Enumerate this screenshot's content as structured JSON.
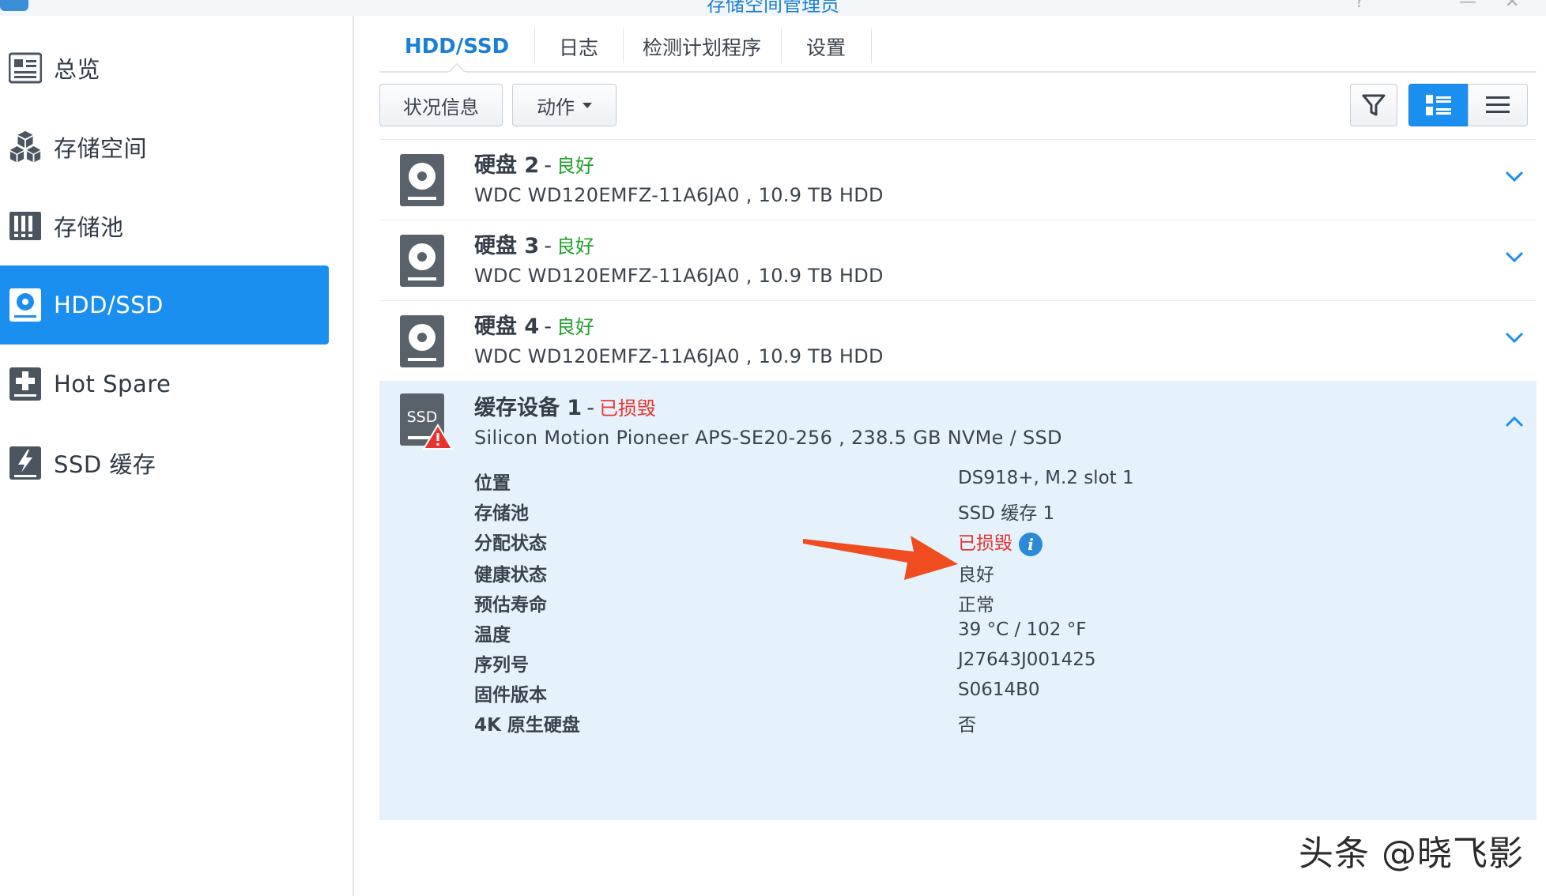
{
  "window": {
    "title": "存储空间管理员"
  },
  "sidebar": {
    "items": [
      {
        "label": "总览",
        "icon": "overview-icon"
      },
      {
        "label": "存储空间",
        "icon": "storage-space-icon"
      },
      {
        "label": "存储池",
        "icon": "storage-pool-icon"
      },
      {
        "label": "HDD/SSD",
        "icon": "disk-icon",
        "active": true
      },
      {
        "label": "Hot Spare",
        "icon": "hot-spare-icon"
      },
      {
        "label": "SSD 缓存",
        "icon": "ssd-cache-icon"
      }
    ]
  },
  "tabs": [
    {
      "label": "HDD/SSD",
      "active": true
    },
    {
      "label": "日志"
    },
    {
      "label": "检测计划程序"
    },
    {
      "label": "设置"
    }
  ],
  "toolbar": {
    "status_button": "状况信息",
    "action_button": "动作",
    "filter_icon": "filter-icon",
    "view_modes": [
      "detail-view-icon",
      "list-view-icon"
    ]
  },
  "disks": [
    {
      "name": "硬盘 2",
      "status": "良好",
      "model": "WDC WD120EMFZ-11A6JA0 , 10.9 TB HDD"
    },
    {
      "name": "硬盘 3",
      "status": "良好",
      "model": "WDC WD120EMFZ-11A6JA0 , 10.9 TB HDD"
    },
    {
      "name": "硬盘 4",
      "status": "良好",
      "model": "WDC WD120EMFZ-11A6JA0 , 10.9 TB HDD"
    }
  ],
  "cache_device": {
    "name": "缓存设备 1",
    "status": "已损毁",
    "model": "Silicon Motion Pioneer APS-SE20-256 , 238.5 GB NVMe / SSD",
    "icon_text": "SSD",
    "details": [
      {
        "key": "位置",
        "value": "DS918+, M.2 slot 1"
      },
      {
        "key": "存储池",
        "value": "SSD 缓存 1"
      },
      {
        "key": "分配状态",
        "value": "已损毁"
      },
      {
        "key": "健康状态",
        "value": "良好"
      },
      {
        "key": "预估寿命",
        "value": "正常"
      },
      {
        "key": "温度",
        "value": "39 °C / 102 °F"
      },
      {
        "key": "序列号",
        "value": "J27643J001425"
      },
      {
        "key": "固件版本",
        "value": "S0614B0"
      },
      {
        "key": "4K 原生硬盘",
        "value": "否"
      }
    ]
  },
  "colors": {
    "accent": "#1a8ff0",
    "good": "#1fa32a",
    "bad": "#e8332f",
    "expanded_bg": "#e6f2fb"
  },
  "watermark": "头条 @晓飞影"
}
